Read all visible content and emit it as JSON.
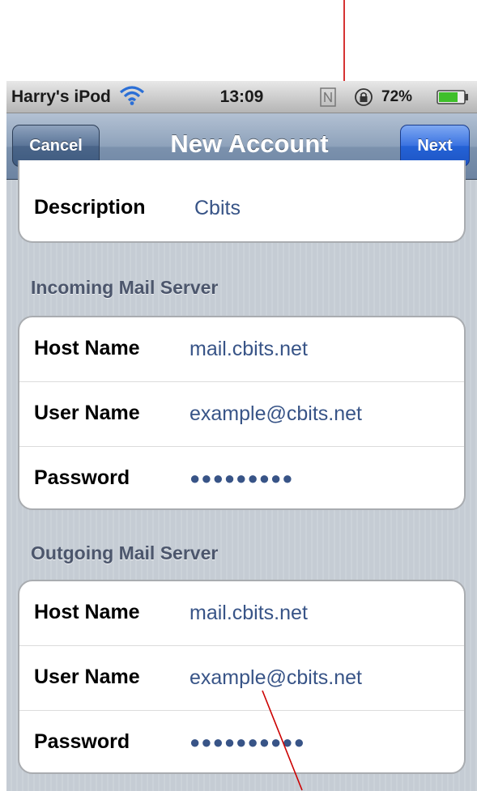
{
  "status_bar": {
    "carrier": "Harry's iPod",
    "time": "13:09",
    "battery_percent": "72%",
    "icons": [
      "wifi-icon",
      "sync-icon",
      "orientation-lock-icon",
      "battery-icon"
    ]
  },
  "nav_bar": {
    "cancel_label": "Cancel",
    "title": "New Account",
    "next_label": "Next"
  },
  "description": {
    "label": "Description",
    "value": "Cbits"
  },
  "incoming": {
    "header": "Incoming Mail Server",
    "rows": [
      {
        "label": "Host Name",
        "value": "mail.cbits.net"
      },
      {
        "label": "User Name",
        "value": "example@cbits.net"
      },
      {
        "label": "Password",
        "value": "●●●●●●●●●"
      }
    ]
  },
  "outgoing": {
    "header": "Outgoing Mail Server",
    "rows": [
      {
        "label": "Host Name",
        "value": "mail.cbits.net"
      },
      {
        "label": "User Name",
        "value": "example@cbits.net"
      },
      {
        "label": "Password",
        "value": "●●●●●●●●●●"
      }
    ]
  },
  "colors": {
    "annotation_arrow": "#cc0000",
    "field_value": "#385487",
    "nav_bar": "#6d84a2",
    "next_button": "#2462d6"
  }
}
